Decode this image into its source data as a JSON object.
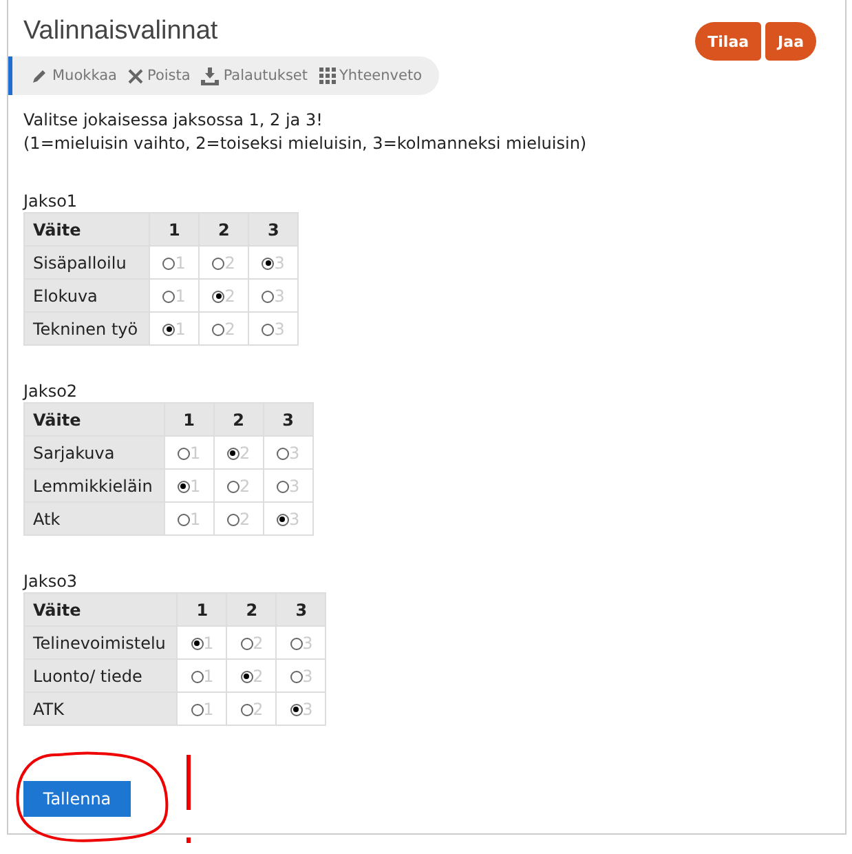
{
  "title": "Valinnaisvalinnat",
  "header_buttons": [
    "Tilaa",
    "Jaa"
  ],
  "toolbar": [
    {
      "kind": "edit",
      "label": "Muokkaa"
    },
    {
      "kind": "delete",
      "label": "Poista"
    },
    {
      "kind": "download",
      "label": "Palautukset"
    },
    {
      "kind": "grid",
      "label": "Yhteenveto"
    }
  ],
  "instructions": [
    "Valitse jokaisessa jaksossa 1, 2 ja 3!",
    "(1=mieluisin vaihto, 2=toiseksi mieluisin, 3=kolmanneksi mieluisin)"
  ],
  "sections": [
    {
      "name": "Jakso1",
      "columns": [
        "Väite",
        "1",
        "2",
        "3"
      ],
      "rows": [
        {
          "label": "Sisäpalloilu",
          "options": [
            {
              "label": "1",
              "selected": false
            },
            {
              "label": "2",
              "selected": false
            },
            {
              "label": "3",
              "selected": true
            }
          ]
        },
        {
          "label": "Elokuva",
          "options": [
            {
              "label": "1",
              "selected": false
            },
            {
              "label": "2",
              "selected": true
            },
            {
              "label": "3",
              "selected": false
            }
          ]
        },
        {
          "label": "Tekninen työ",
          "options": [
            {
              "label": "1",
              "selected": true
            },
            {
              "label": "2",
              "selected": false
            },
            {
              "label": "3",
              "selected": false
            }
          ]
        }
      ]
    },
    {
      "name": "Jakso2",
      "columns": [
        "Väite",
        "1",
        "2",
        "3"
      ],
      "rows": [
        {
          "label": "Sarjakuva",
          "options": [
            {
              "label": "1",
              "selected": false
            },
            {
              "label": "2",
              "selected": true
            },
            {
              "label": "3",
              "selected": false
            }
          ]
        },
        {
          "label": "Lemmikkieläin",
          "options": [
            {
              "label": "1",
              "selected": true
            },
            {
              "label": "2",
              "selected": false
            },
            {
              "label": "3",
              "selected": false
            }
          ]
        },
        {
          "label": "Atk",
          "options": [
            {
              "label": "1",
              "selected": false
            },
            {
              "label": "2",
              "selected": false
            },
            {
              "label": "3",
              "selected": true
            }
          ]
        }
      ]
    },
    {
      "name": "Jakso3",
      "columns": [
        "Väite",
        "1",
        "2",
        "3"
      ],
      "rows": [
        {
          "label": "Telinevoimistelu",
          "options": [
            {
              "label": "1",
              "selected": true
            },
            {
              "label": "2",
              "selected": false
            },
            {
              "label": "3",
              "selected": false
            }
          ]
        },
        {
          "label": "Luonto/ tiede",
          "options": [
            {
              "label": "1",
              "selected": false
            },
            {
              "label": "2",
              "selected": true
            },
            {
              "label": "3",
              "selected": false
            }
          ]
        },
        {
          "label": "ATK",
          "options": [
            {
              "label": "1",
              "selected": false
            },
            {
              "label": "2",
              "selected": false
            },
            {
              "label": "3",
              "selected": true
            }
          ]
        }
      ]
    }
  ],
  "save_button": "Tallenna"
}
